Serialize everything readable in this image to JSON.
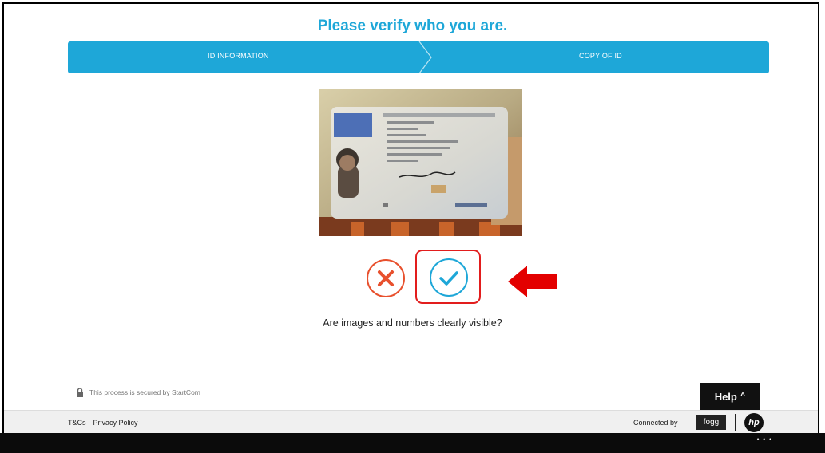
{
  "header": {
    "title": "Please verify who you are."
  },
  "steps": [
    {
      "label": "ID INFORMATION"
    },
    {
      "label": "COPY OF ID"
    }
  ],
  "photo": {
    "icon": "id-card-photo"
  },
  "actions": {
    "reject_icon": "close-icon",
    "confirm_icon": "check-icon",
    "question": "Are images and numbers clearly visible?"
  },
  "secure": {
    "text": "This process is secured by StartCom"
  },
  "help": {
    "label": "Help",
    "chevron": "^"
  },
  "footer": {
    "links": [
      "T&Cs",
      "Privacy Policy"
    ],
    "connected": "Connected by",
    "fogg": "fogg",
    "hp": "hp"
  },
  "bottom_bar": {
    "dots": "• • •"
  },
  "colors": {
    "accent": "#1ea7d8",
    "reject": "#e8502d",
    "highlight": "#e21d1d"
  }
}
